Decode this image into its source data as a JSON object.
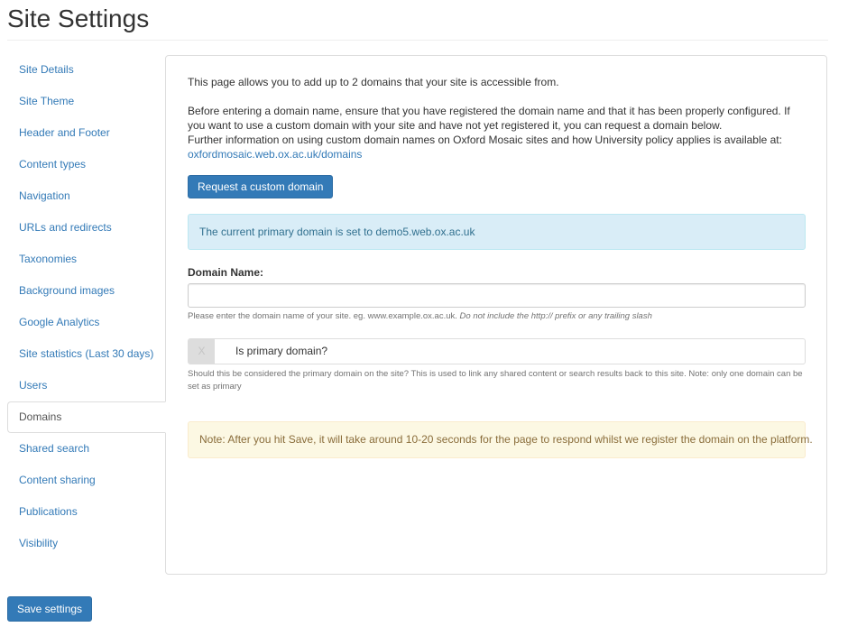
{
  "header": {
    "title": "Site Settings"
  },
  "sidebar": {
    "items": [
      {
        "label": "Site Details",
        "active": false
      },
      {
        "label": "Site Theme",
        "active": false
      },
      {
        "label": "Header and Footer",
        "active": false
      },
      {
        "label": "Content types",
        "active": false
      },
      {
        "label": "Navigation",
        "active": false
      },
      {
        "label": "URLs and redirects",
        "active": false
      },
      {
        "label": "Taxonomies",
        "active": false
      },
      {
        "label": "Background images",
        "active": false
      },
      {
        "label": "Google Analytics",
        "active": false
      },
      {
        "label": "Site statistics (Last 30 days)",
        "active": false
      },
      {
        "label": "Users",
        "active": false
      },
      {
        "label": "Domains",
        "active": true
      },
      {
        "label": "Shared search",
        "active": false
      },
      {
        "label": "Content sharing",
        "active": false
      },
      {
        "label": "Publications",
        "active": false
      },
      {
        "label": "Visibility",
        "active": false
      }
    ]
  },
  "domains": {
    "intro": "This page allows you to add up to 2 domains that your site is accessible from.",
    "before_text_1": "Before entering a domain name, ensure that you have registered the domain name and that it has been properly configured. If you want to use a custom domain with your site and have not yet registered it, you can request a domain below.",
    "before_text_2": "Further information on using custom domain names on Oxford Mosaic sites and how University policy applies is available at:",
    "info_link": "oxfordmosaic.web.ox.ac.uk/domains",
    "request_button": "Request a custom domain",
    "primary_alert": "The current primary domain is set to demo5.web.ox.ac.uk",
    "domain_name_label": "Domain Name:",
    "domain_name_value": "",
    "domain_name_placeholder": "",
    "domain_help_plain": "Please enter the domain name of your site. eg. www.example.ox.ac.uk.",
    "domain_help_italic": "Do not include the http:// prefix or any trailing slash",
    "primary_toggle": {
      "icon": "x-icon",
      "glyph": "X",
      "checked": false,
      "label": "Is primary domain?"
    },
    "primary_help": "Should this be considered the primary domain on the site? This is used to link any shared content or search results back to this site. Note: only one domain can be set as primary",
    "save_note": "Note: After you hit Save, it will take around 10-20 seconds for the page to respond whilst we register the domain on the platform."
  },
  "footer": {
    "save_button": "Save settings"
  },
  "colors": {
    "link": "#337ab7",
    "primary_button": "#337ab7",
    "info_bg": "#d9edf7",
    "info_text": "#31708f",
    "warning_bg": "#fcf8e3",
    "warning_text": "#8a6d3b"
  }
}
